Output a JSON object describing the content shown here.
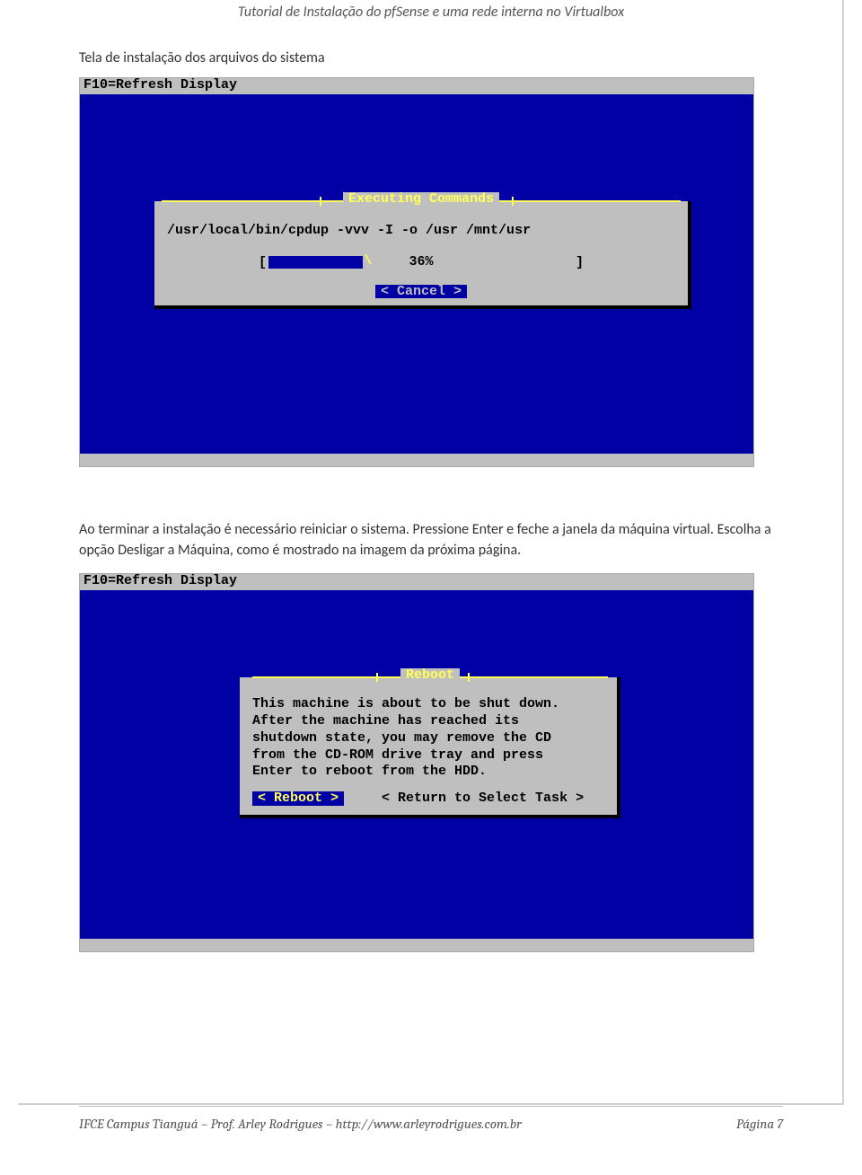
{
  "header": "Tutorial de Instalação do pfSense e uma rede interna no Virtualbox",
  "caption1": "Tela de instalação dos arquivos do sistema",
  "console": {
    "topbar": "F10=Refresh Display",
    "dlg1": {
      "title": "Executing Commands",
      "command": "/usr/local/bin/cpdup -vvv -I -o /usr /mnt/usr",
      "spinner": "\\",
      "percent_label": "36%",
      "percent_value": 36,
      "cancel": "< Cancel >"
    },
    "dlg2": {
      "title": "Reboot",
      "message": "This machine is about to be shut down.\nAfter the machine has reached its\nshutdown state, you may remove the CD\nfrom the CD-ROM drive tray and press\nEnter to reboot from the HDD.",
      "reboot": "< Reboot >",
      "return": "< Return to Select Task >"
    }
  },
  "body_text": "Ao terminar a instalação é necessário reiniciar o sistema. Pressione Enter e feche a janela da máquina virtual. Escolha a opção Desligar a Máquina, como é mostrado na imagem da próxima página.",
  "footer_left": "IFCE Campus Tianguá – Prof. Arley Rodrigues – http://www.arleyrodrigues.com.br",
  "footer_right": "Página 7"
}
